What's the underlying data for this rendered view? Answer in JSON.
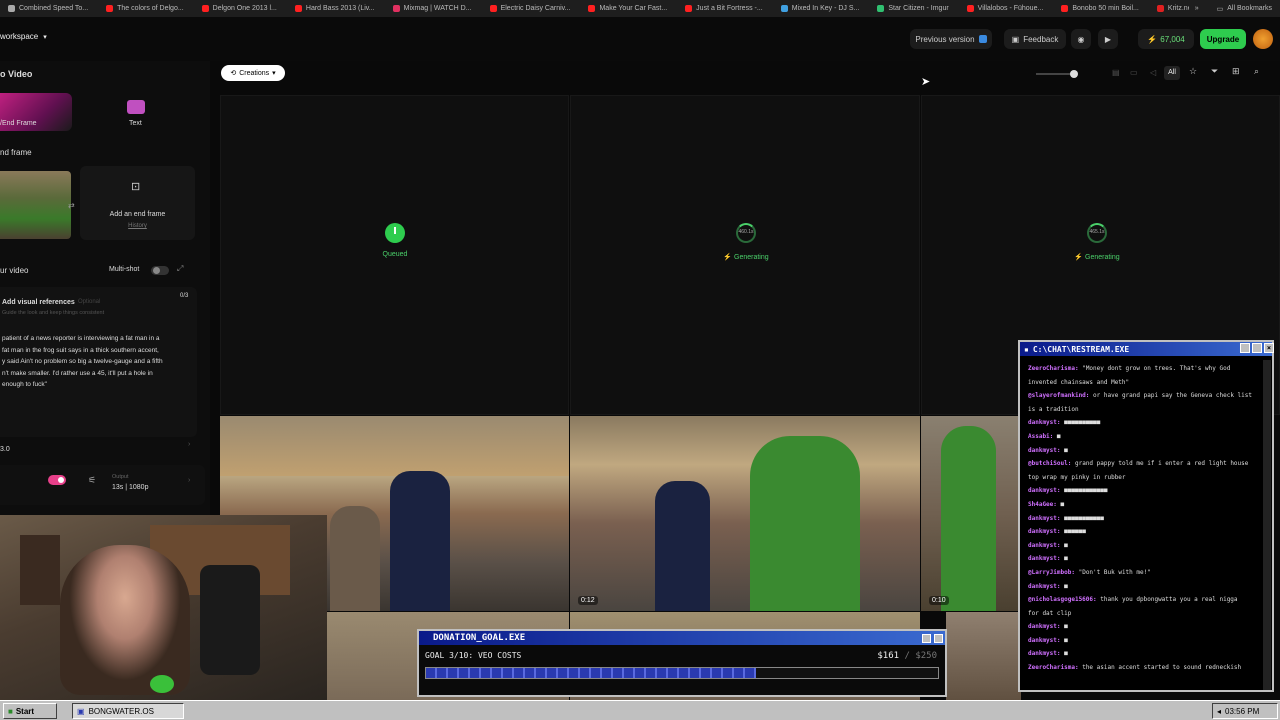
{
  "bookmarks": [
    {
      "label": "Combined Speed To...",
      "color": "#aaaaaa"
    },
    {
      "label": "The colors of Delgo...",
      "color": "#ff2020"
    },
    {
      "label": "Delgon One 2013 l...",
      "color": "#ff2020"
    },
    {
      "label": "Hard Bass 2013 (Liv...",
      "color": "#ff2020"
    },
    {
      "label": "Mixmag | WATCH D...",
      "color": "#e03060"
    },
    {
      "label": "Electric Daisy Carniv...",
      "color": "#ff2020"
    },
    {
      "label": "Make Your Car Fast...",
      "color": "#ff2020"
    },
    {
      "label": "Just a Bit Fortress -...",
      "color": "#ff2020"
    },
    {
      "label": "Mixed In Key - DJ S...",
      "color": "#40a0e0"
    },
    {
      "label": "Star Citizen - Imgur",
      "color": "#30c070"
    },
    {
      "label": "Villalobos - Fühoue...",
      "color": "#ff2020"
    },
    {
      "label": "Bonobo 50 min Boil...",
      "color": "#ff2020"
    },
    {
      "label": "Kritz.net",
      "color": "#e02020"
    }
  ],
  "bookmarks_overflow": "»",
  "all_bookmarks": "All Bookmarks",
  "header": {
    "workspace": "workspace",
    "previous_version": "Previous version",
    "feedback": "Feedback",
    "credits": "67,004",
    "upgrade": "Upgrade"
  },
  "sidebar": {
    "title": "o Video",
    "tab_end_frame": "/End Frame",
    "tab_text": "Text",
    "section_end_frame": "nd frame",
    "add_end_frame": "Add an end frame",
    "history": "History",
    "your_video": "ur video",
    "multi_shot": "Multi-shot",
    "add_visual_refs": "Add visual references",
    "optional": "Optional",
    "ref_count": "0/3",
    "guide_text": "Guide the look and keep things consistent",
    "prompt": [
      "patient of a news reporter is interviewing a fat man in a",
      "fat man in the frog suit says in a thick southern accent,",
      "y said Ain't no problem so big a twelve-gauge and a fifth",
      "n't make smaller. I'd rather use a 45, it'll put a hole in",
      "enough to fuck\""
    ],
    "model": "3.0",
    "output_label": "Output",
    "output_value": "13s | 1080p"
  },
  "main": {
    "filter": "Creations",
    "filter_all": "All",
    "slots": [
      {
        "label": "Queued",
        "timer": ""
      },
      {
        "label": "Generating",
        "timer": "460.1s"
      },
      {
        "label": "Generating",
        "timer": "465.1s"
      }
    ],
    "thumb_badges": [
      "0:12",
      "0:10"
    ]
  },
  "chat": {
    "title": "C:\\CHAT\\RESTREAM.EXE",
    "lines": [
      {
        "user": "ZeeroCharisma:",
        "text": "\"Money dont grow on trees. That's why God"
      },
      {
        "user": "",
        "text": "invented chainsaws and Meth\""
      },
      {
        "user": "@slayerofmankind:",
        "text": "or have grand papi say the Geneva check list"
      },
      {
        "user": "",
        "text": "is a tradition"
      },
      {
        "user": "dankmyst:",
        "text": "■■■■■■■■■■"
      },
      {
        "user": "Assabi:",
        "text": "■"
      },
      {
        "user": "dankmyst:",
        "text": "■"
      },
      {
        "user": "@butchiSoul:",
        "text": "grand pappy told me if i enter a red light house"
      },
      {
        "user": "",
        "text": "top wrap my pinky in rubber"
      },
      {
        "user": "dankmyst:",
        "text": "■■■■■■■■■■■■"
      },
      {
        "user": "Sh4aGee:",
        "text": "■"
      },
      {
        "user": "dankmyst:",
        "text": "■■■■■■■■■■■"
      },
      {
        "user": "dankmyst:",
        "text": "■■■■■■"
      },
      {
        "user": "dankmyst:",
        "text": "■"
      },
      {
        "user": "dankmyst:",
        "text": "■"
      },
      {
        "user": "@LarryJimbob:",
        "text": "\"Don't Buk with me!\""
      },
      {
        "user": "dankmyst:",
        "text": "■"
      },
      {
        "user": "@nicholasgoge15606:",
        "text": "thank you dpbongwatta you a real nigga"
      },
      {
        "user": "",
        "text": "for dat clip"
      },
      {
        "user": "dankmyst:",
        "text": "■"
      },
      {
        "user": "dankmyst:",
        "text": "■"
      },
      {
        "user": "dankmyst:",
        "text": "■"
      },
      {
        "user": "ZeeroCharisma:",
        "text": "the asian accent started to sound redneckish"
      }
    ]
  },
  "donation": {
    "title": "DONATION_GOAL.EXE",
    "goal_text": "GOAL 3/10: VEO COSTS",
    "amount": "$161",
    "target": "/ $250",
    "progress": 0.644
  },
  "taskbar": {
    "start": "Start",
    "task": "BONGWATER.OS",
    "clock": "03:56 PM"
  },
  "colors": {
    "accent_green": "#2ecc4e",
    "status_green": "#4ad06a",
    "pink": "#e8408a"
  }
}
